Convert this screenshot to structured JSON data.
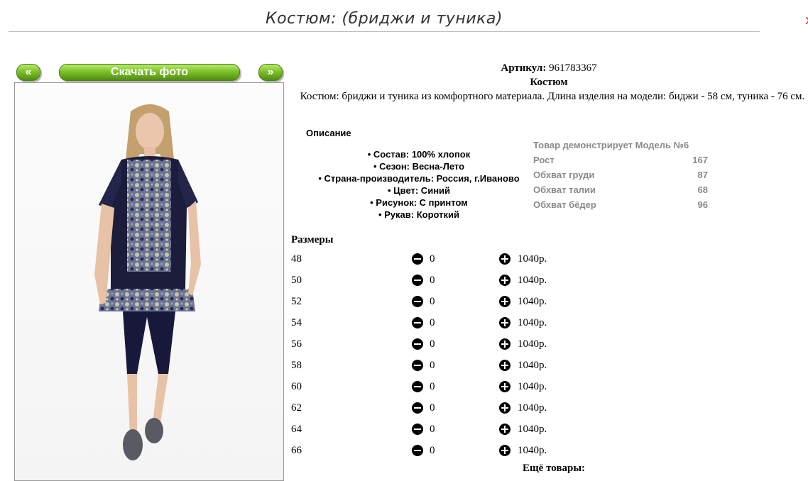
{
  "page": {
    "title": "Костюм:  (бриджи и туника)",
    "close_glyph": "x"
  },
  "nav": {
    "prev_label": "«",
    "download_label": "Скачать фото",
    "next_label": "»"
  },
  "product": {
    "article_label": "Артикул:",
    "article_value": "961783367",
    "name": "Костюм",
    "description": "Костюм: бриджи и туника из комфортного материала. Длина изделия на модели: биджи - 58 см, туника - 76 см."
  },
  "details": {
    "title": "Описание",
    "items": [
      "Состав: 100% хлопок",
      "Сезон: Весна-Лето",
      "Страна-производитель: Россия, г.Иваново",
      "Цвет: Синий",
      "Рисунок: С принтом",
      "Рукав: Короткий"
    ]
  },
  "model": {
    "header": "Товар демонстрирует Модель №6",
    "rows": [
      {
        "label": "Рост",
        "value": "167"
      },
      {
        "label": "Обхват груди",
        "value": "87"
      },
      {
        "label": "Обхват талии",
        "value": "68"
      },
      {
        "label": "Обхват бёдер",
        "value": "96"
      }
    ]
  },
  "sizes": {
    "title": "Размеры",
    "rows": [
      {
        "size": "48",
        "qty": "0",
        "price": "1040р."
      },
      {
        "size": "50",
        "qty": "0",
        "price": "1040р."
      },
      {
        "size": "52",
        "qty": "0",
        "price": "1040р."
      },
      {
        "size": "54",
        "qty": "0",
        "price": "1040р."
      },
      {
        "size": "56",
        "qty": "0",
        "price": "1040р."
      },
      {
        "size": "58",
        "qty": "0",
        "price": "1040р."
      },
      {
        "size": "60",
        "qty": "0",
        "price": "1040р."
      },
      {
        "size": "62",
        "qty": "0",
        "price": "1040р."
      },
      {
        "size": "64",
        "qty": "0",
        "price": "1040р."
      },
      {
        "size": "66",
        "qty": "0",
        "price": "1040р."
      }
    ]
  },
  "footer": {
    "more_label": "Ещё товары:"
  },
  "colors": {
    "button_green": "#7fc02a",
    "model_text": "#8a8a8a",
    "garment_navy": "#1c1d3a"
  }
}
